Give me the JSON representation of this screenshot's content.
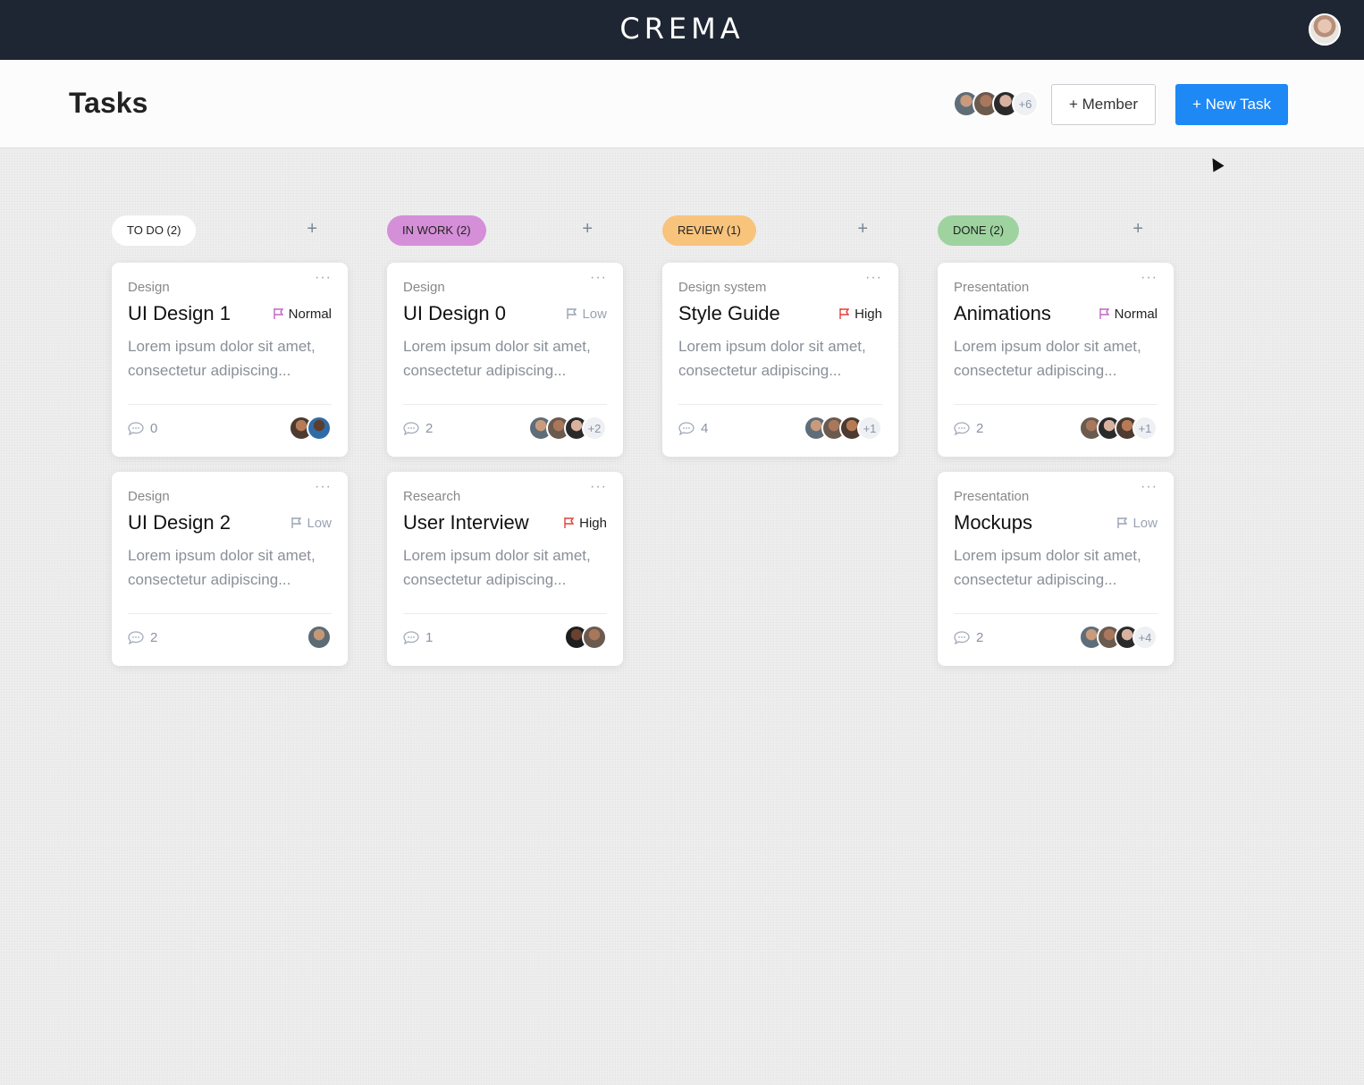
{
  "app": {
    "brand": "CREMA"
  },
  "header": {
    "title": "Tasks",
    "members_more": "+6",
    "member_button": "+ Member",
    "new_task_button": "+ New Task"
  },
  "colors": {
    "todo": "#ffffff",
    "inwork": "#d58fd8",
    "review": "#f8c47c",
    "done": "#9ed39f",
    "primary": "#1e88f5"
  },
  "columns": [
    {
      "label": "TO DO (2)",
      "add": "+",
      "cards": [
        {
          "category": "Design",
          "title": "UI Design 1",
          "priority": "Normal",
          "desc": "Lorem ipsum dolor sit amet, consectetur adipiscing...",
          "comments": "0",
          "more": ""
        },
        {
          "category": "Design",
          "title": "UI Design 2",
          "priority": "Low",
          "desc": "Lorem ipsum dolor sit amet, consectetur adipiscing...",
          "comments": "2",
          "more": ""
        }
      ]
    },
    {
      "label": "IN WORK (2)",
      "add": "+",
      "cards": [
        {
          "category": "Design",
          "title": "UI Design 0",
          "priority": "Low",
          "desc": "Lorem ipsum dolor sit amet, consectetur adipiscing...",
          "comments": "2",
          "more": "+2"
        },
        {
          "category": "Research",
          "title": "User Interview",
          "priority": "High",
          "desc": "Lorem ipsum dolor sit amet, consectetur adipiscing...",
          "comments": "1",
          "more": ""
        }
      ]
    },
    {
      "label": "REVIEW (1)",
      "add": "+",
      "cards": [
        {
          "category": "Design system",
          "title": "Style Guide",
          "priority": "High",
          "desc": "Lorem ipsum dolor sit amet, consectetur adipiscing...",
          "comments": "4",
          "more": "+1"
        }
      ]
    },
    {
      "label": "DONE (2)",
      "add": "+",
      "cards": [
        {
          "category": "Presentation",
          "title": "Animations",
          "priority": "Normal",
          "desc": "Lorem ipsum dolor sit amet, consectetur adipiscing...",
          "comments": "2",
          "more": "+1"
        },
        {
          "category": "Presentation",
          "title": "Mockups",
          "priority": "Low",
          "desc": "Lorem ipsum dolor sit amet, consectetur adipiscing...",
          "comments": "2",
          "more": "+4"
        }
      ]
    }
  ]
}
